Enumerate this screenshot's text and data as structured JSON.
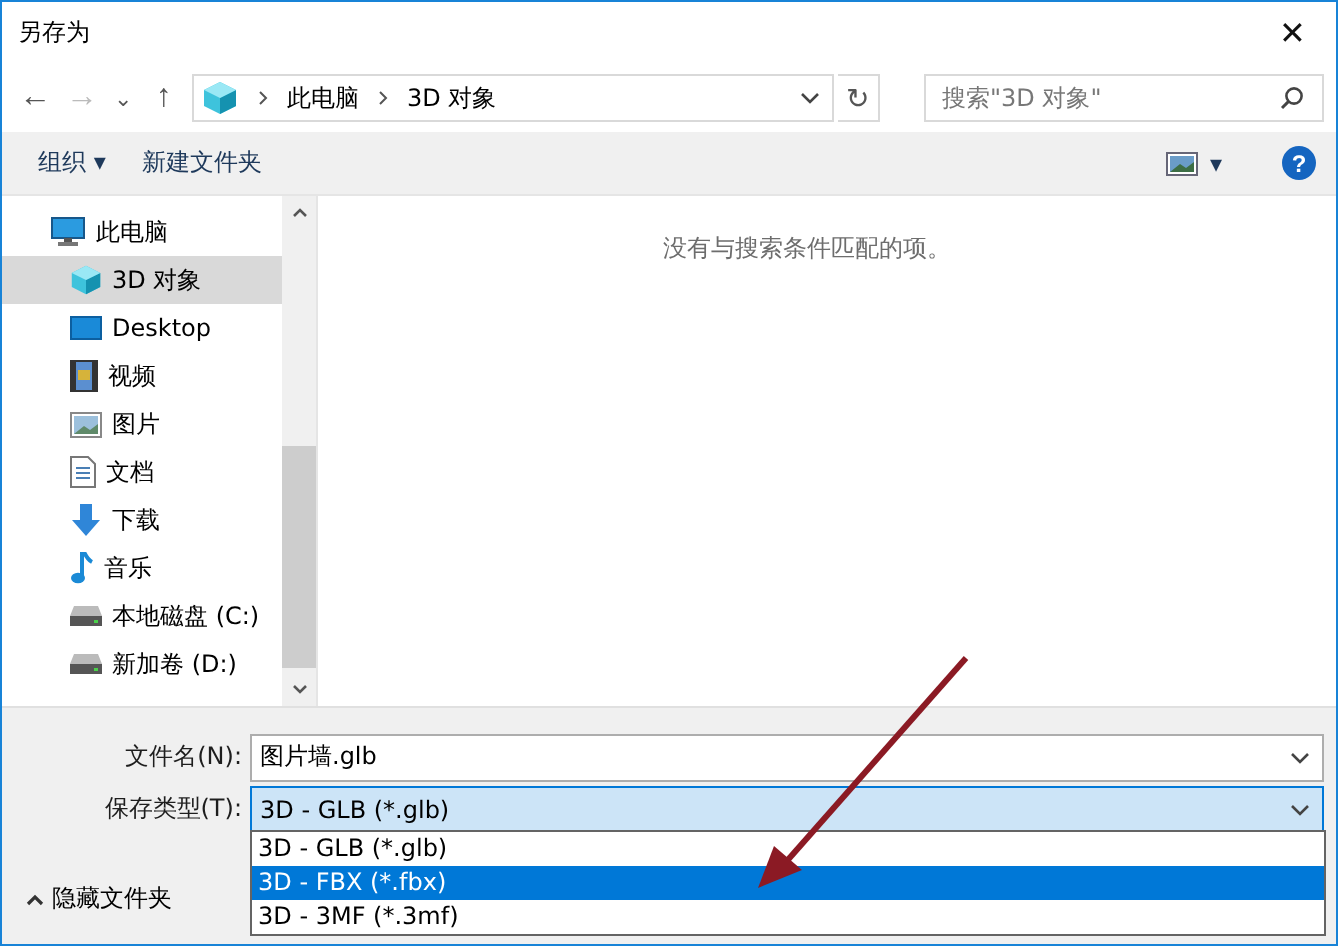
{
  "window": {
    "title": "另存为",
    "close": "✕"
  },
  "nav": {
    "back": "←",
    "forward": "→",
    "recent": "⌄",
    "up": "↑",
    "path": [
      "此电脑",
      "3D 对象"
    ],
    "refresh": "↻",
    "search_placeholder": "搜索\"3D 对象\""
  },
  "toolbar": {
    "organize": "组织 ▾",
    "new_folder": "新建文件夹",
    "view": "▾",
    "help": "?"
  },
  "sidebar": {
    "items": [
      {
        "label": "此电脑",
        "kind": "pc",
        "selected": false,
        "children": [
          {
            "label": "3D 对象",
            "kind": "cube",
            "selected": true
          },
          {
            "label": "Desktop",
            "kind": "desktop",
            "selected": false
          },
          {
            "label": "视频",
            "kind": "video",
            "selected": false
          },
          {
            "label": "图片",
            "kind": "image",
            "selected": false
          },
          {
            "label": "文档",
            "kind": "doc",
            "selected": false
          },
          {
            "label": "下载",
            "kind": "download",
            "selected": false
          },
          {
            "label": "音乐",
            "kind": "music",
            "selected": false
          },
          {
            "label": "本地磁盘 (C:)",
            "kind": "drive",
            "selected": false
          },
          {
            "label": "新加卷 (D:)",
            "kind": "drive",
            "selected": false
          }
        ]
      }
    ]
  },
  "content": {
    "empty_message": "没有与搜索条件匹配的项。"
  },
  "form": {
    "filename_label": "文件名(N):",
    "filename": "图片墙.glb",
    "type_label": "保存类型(T):",
    "type": "3D - GLB (*.glb)",
    "options": [
      {
        "label": "3D - GLB (*.glb)",
        "selected": false
      },
      {
        "label": "3D - FBX (*.fbx)",
        "selected": true
      },
      {
        "label": "3D - 3MF (*.3mf)",
        "selected": false
      }
    ]
  },
  "hide_folders": "隐藏文件夹"
}
